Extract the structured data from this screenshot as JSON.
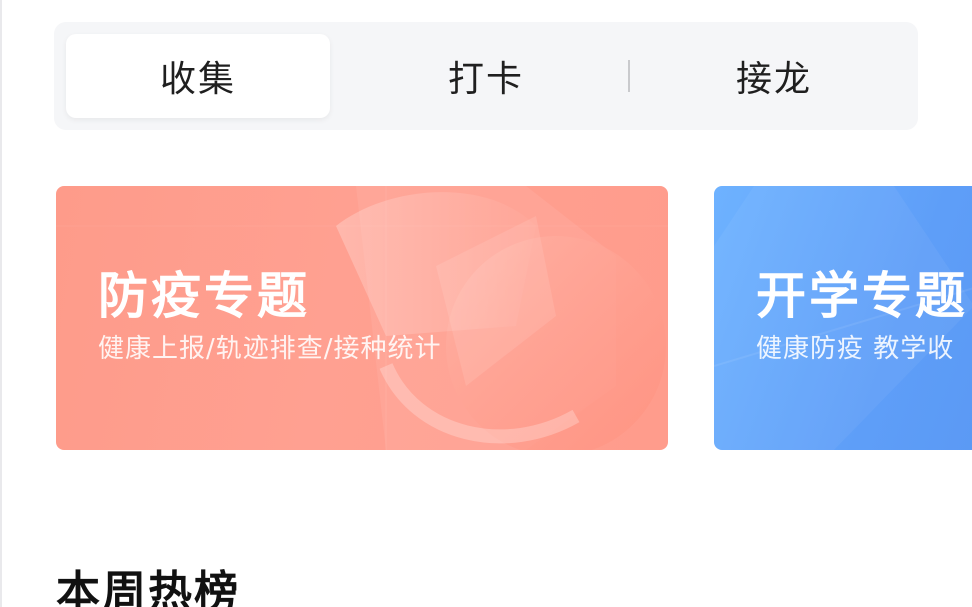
{
  "tabs": {
    "items": [
      {
        "label": "收集",
        "active": true
      },
      {
        "label": "打卡",
        "active": false
      },
      {
        "label": "接龙",
        "active": false
      }
    ]
  },
  "banners": [
    {
      "title": "防疫专题",
      "subtitle": "健康上报/轨迹排查/接种统计",
      "color": "#ff9c8c"
    },
    {
      "title": "开学专题",
      "subtitle": "健康防疫  教学收",
      "color": "#5e9ef8"
    }
  ],
  "section": {
    "title": "本周热榜"
  }
}
